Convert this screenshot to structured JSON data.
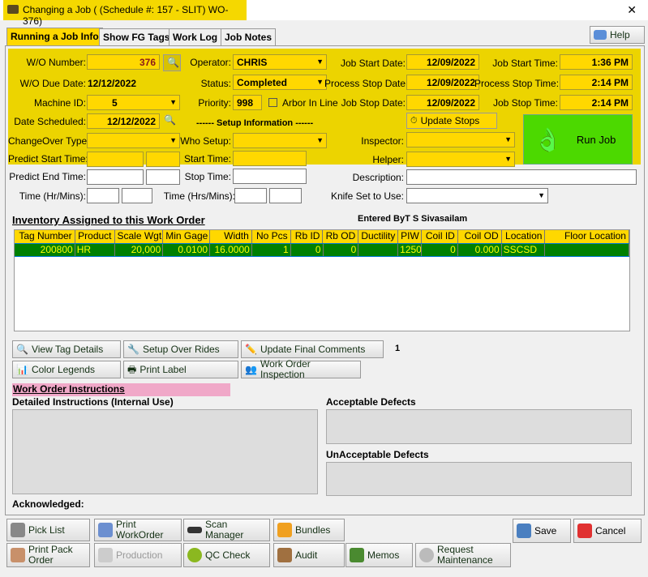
{
  "window": {
    "title": "Changing a Job  (  (Schedule #: 157 - SLIT) WO-376)",
    "close": "✕"
  },
  "tabs": [
    "Running a Job Info",
    "Show FG Tags",
    "Work Log",
    "Job Notes"
  ],
  "help": "Help",
  "form": {
    "wo_number_label": "W/O Number:",
    "wo_number": "376",
    "wo_due_label": "W/O Due Date:",
    "wo_due": "12/12/2022",
    "machine_label": "Machine ID:",
    "machine": "5",
    "date_sched_label": "Date Scheduled:",
    "date_sched": "12/12/2022",
    "changeover_label": "ChangeOver Type:",
    "changeover": "",
    "predict_start_label": "Predict Start Time:",
    "predict_end_label": "Predict End Time:",
    "time_hr_label": "Time (Hr/Mins):",
    "operator_label": "Operator:",
    "operator": "CHRIS",
    "status_label": "Status:",
    "status": "Completed",
    "priority_label": "Priority:",
    "priority": "998",
    "arbor_label": "Arbor In Line",
    "arbor_checked": false,
    "setup_info": "------  Setup Information  ------",
    "who_setup_label": "Who Setup:",
    "start_time_label": "Start Time:",
    "stop_time_label": "Stop Time:",
    "time_hrs_label": "Time (Hrs/Mins):",
    "job_start_date_label": "Job Start Date:",
    "job_start_date": "12/09/2022",
    "process_stop_date_label": "Process Stop Date",
    "process_stop_date": "12/09/2022",
    "job_stop_date_label": "Job Stop Date:",
    "job_stop_date": "12/09/2022",
    "job_start_time_label": "Job Start Time:",
    "job_start_time": "1:36 PM",
    "process_stop_time_label": "Process Stop Time:",
    "process_stop_time": "2:14 PM",
    "job_stop_time_label": "Job Stop Time:",
    "job_stop_time": "2:14 PM",
    "update_stops": "Update Stops",
    "run_job": "Run Job",
    "inspector_label": "Inspector:",
    "helper_label": "Helper:",
    "description_label": "Description:",
    "knife_label": "Knife Set to Use:"
  },
  "inventory": {
    "title": "Inventory Assigned to this Work Order",
    "entered_by": "Entered ByT S Sivasailam",
    "columns": [
      "Tag Number",
      "Product",
      "Scale Wgt",
      "Min Gage",
      "Width",
      "No Pcs",
      "Rb ID",
      "Rb OD",
      "Ductility",
      "PIW",
      "Coil ID",
      "Coil OD",
      "Location",
      "Floor Location"
    ],
    "rows": [
      [
        "200800",
        "HR",
        "20,000",
        "0.0100",
        "16.0000",
        "1",
        "0",
        "0",
        "",
        "1250",
        "0",
        "0.000",
        "SSCSD",
        ""
      ]
    ]
  },
  "actions": {
    "view_tag": "View Tag Details",
    "setup_over": "Setup Over Rides",
    "update_final": "Update Final Comments",
    "color_legends": "Color Legends",
    "print_label": "Print Label",
    "wo_inspection": "Work Order Inspection",
    "count": "1"
  },
  "instructions": {
    "title": "Work Order Instructions",
    "detailed": "Detailed Instructions (Internal Use)",
    "acceptable": "Acceptable Defects",
    "unacceptable": "UnAcceptable Defects",
    "acknowledged": "Acknowledged:"
  },
  "bottom": {
    "pick_list": "Pick List",
    "print_wo": "Print WorkOrder",
    "scan": "Scan Manager",
    "bundles": "Bundles",
    "save": "Save",
    "cancel": "Cancel",
    "print_pack": "Print Pack Order",
    "production": "Production",
    "qc": "QC Check",
    "audit": "Audit",
    "memos": "Memos",
    "request": "Request Maintenance"
  },
  "colors": {
    "panel": "#ecd400",
    "field": "#ffd800",
    "row": "#008000",
    "run_job": "#4cd900"
  }
}
